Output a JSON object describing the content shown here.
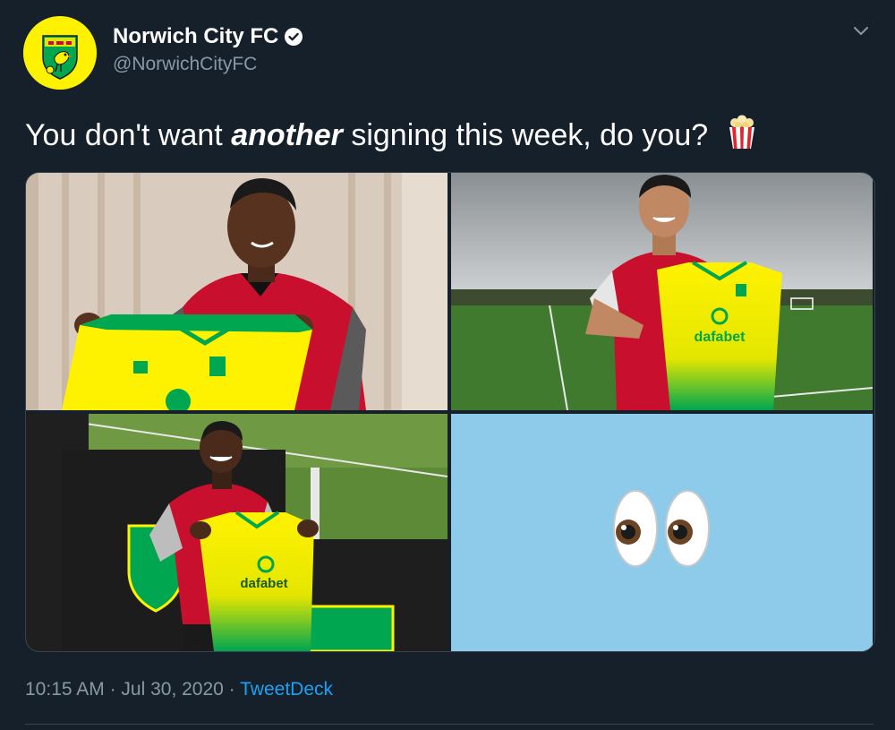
{
  "account": {
    "display_name": "Norwich City FC",
    "handle": "@NorwichCityFC",
    "verified": true
  },
  "tweet": {
    "text_before": "You don't want ",
    "text_emphasis": "another",
    "text_after": " signing this week, do you?",
    "trailing_emoji": "popcorn-icon"
  },
  "media": [
    {
      "kind": "photo",
      "jersey_sponsor": ""
    },
    {
      "kind": "photo",
      "jersey_sponsor": "dafabet"
    },
    {
      "kind": "photo",
      "jersey_sponsor": "dafabet"
    },
    {
      "kind": "emoji",
      "emoji_name": "eyes-icon"
    }
  ],
  "meta": {
    "time": "10:15 AM",
    "separator": " · ",
    "date": "Jul 30, 2020",
    "source": "TweetDeck"
  },
  "colors": {
    "background": "#15202b",
    "secondary_text": "#8899a6",
    "link": "#1da1f2",
    "club_yellow": "#fff200",
    "club_green": "#00a650",
    "emoji_tile": "#8ecbea"
  }
}
